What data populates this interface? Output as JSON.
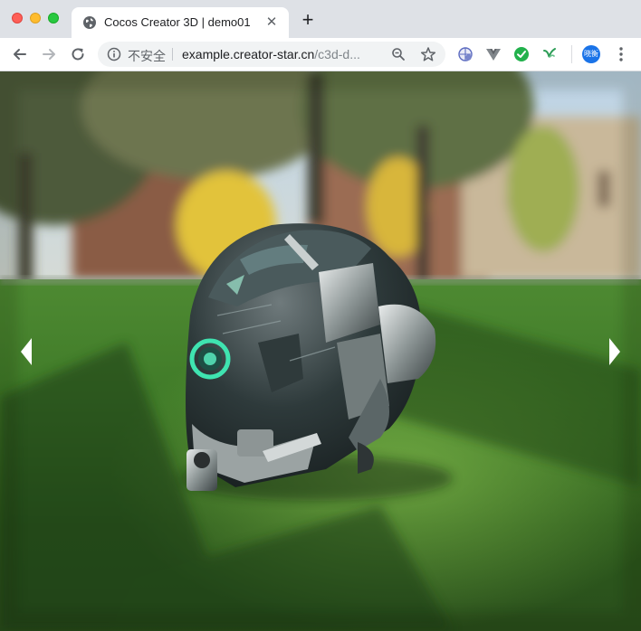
{
  "window": {
    "tab": {
      "title": "Cocos Creator 3D | demo01",
      "favicon": "globe-icon",
      "close_glyph": "✕"
    },
    "new_tab_glyph": "+"
  },
  "toolbar": {
    "security_label": "不安全",
    "url_host": "example.creator-star.cn",
    "url_path": "/c3d-d...",
    "avatar_text": "晓衡",
    "extensions": [
      "extension-globe-icon",
      "vue-devtools-icon",
      "extension-check-icon",
      "extension-leaf-icon"
    ]
  },
  "viewport": {
    "scene": "3d-helmet-model-on-park-lawn",
    "prev_control": "chevron-left-icon",
    "next_control": "chevron-right-icon"
  },
  "colors": {
    "tabstrip": "#dee1e6",
    "toolbar": "#ffffff",
    "omnibox": "#f1f3f4",
    "avatar": "#1a73e8",
    "ext_green": "#22b14c",
    "helmet_ring": "#3fe3b0"
  }
}
